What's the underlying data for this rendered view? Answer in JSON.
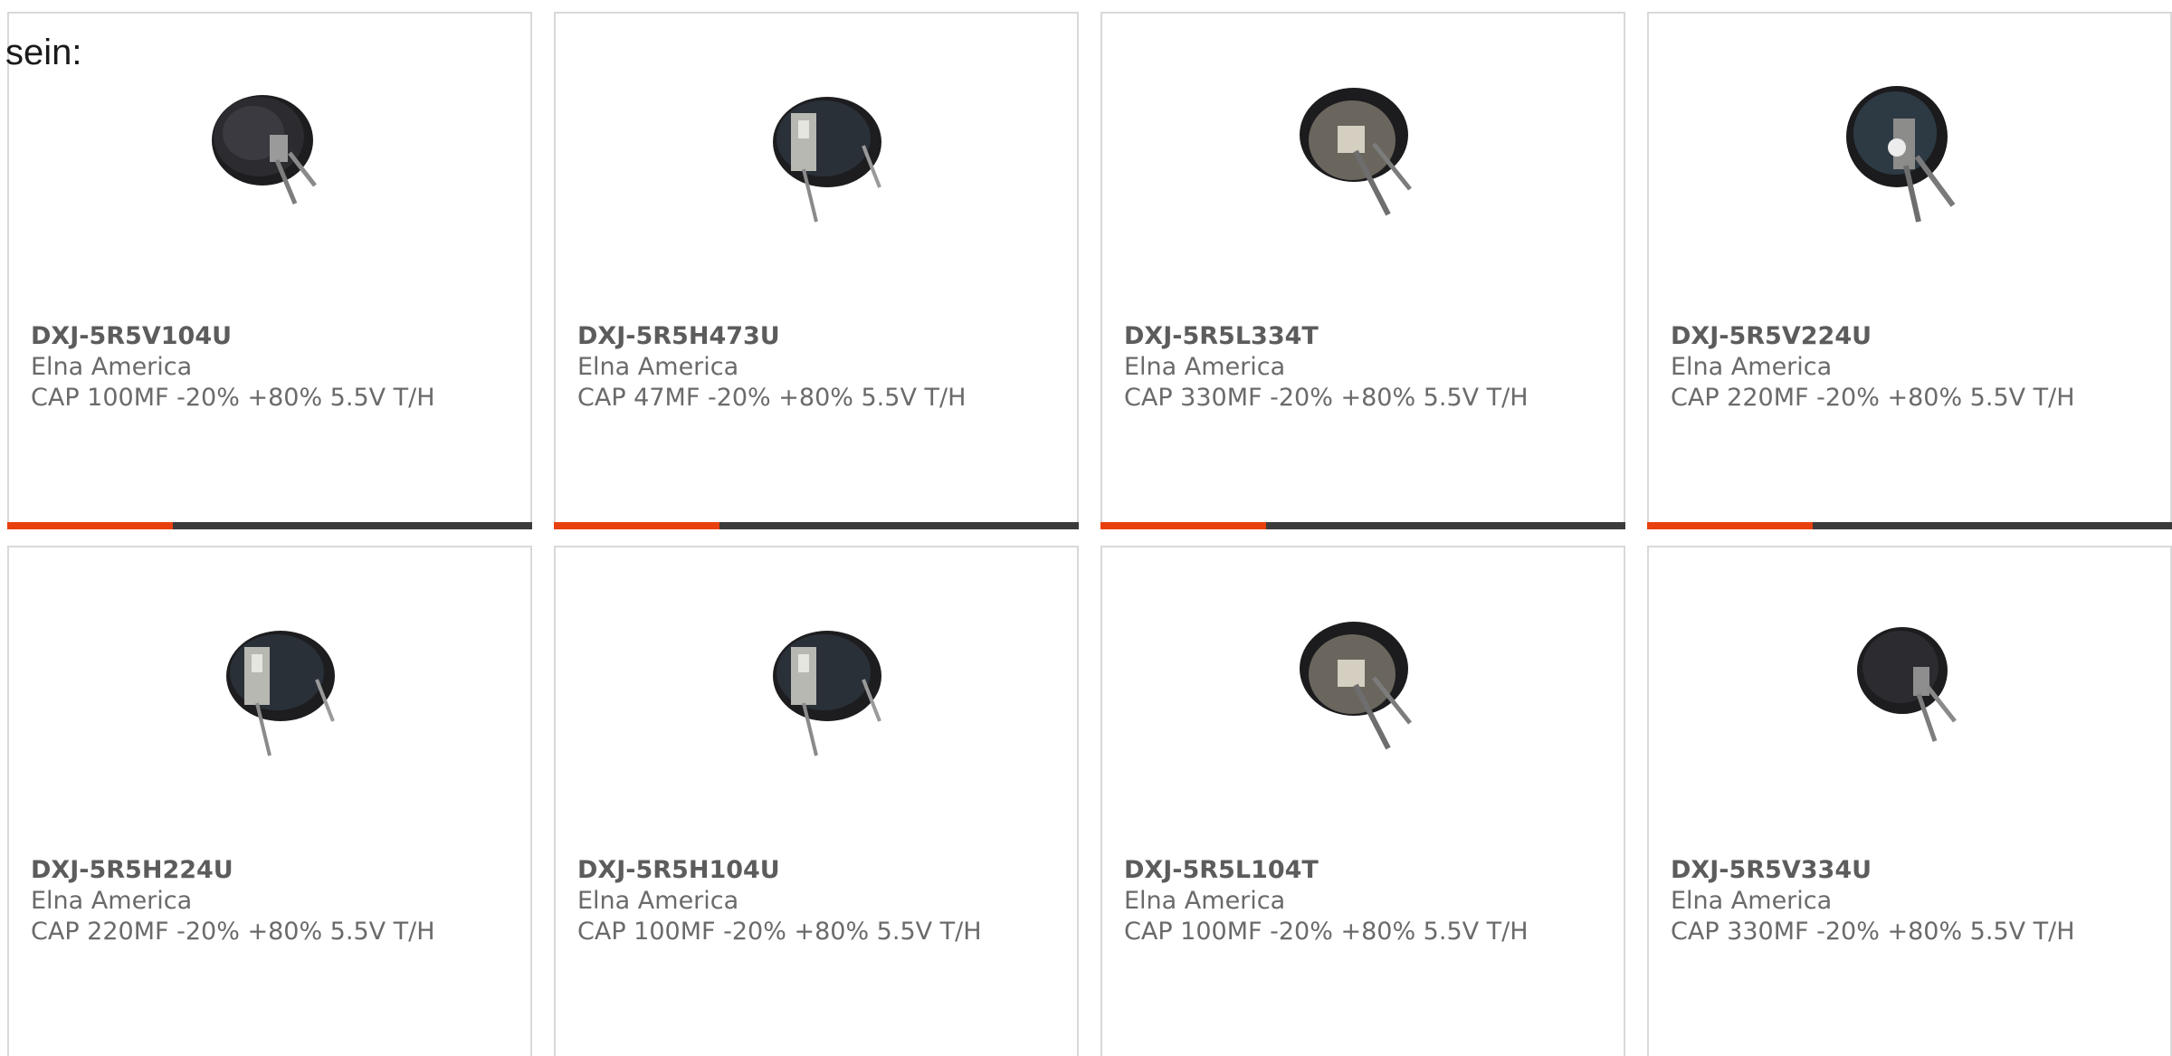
{
  "intro_text": "sein:",
  "colors": {
    "accent": "#e8410f",
    "bar": "#3b3b3b",
    "border": "#d9d9d9"
  },
  "products": [
    {
      "part_number": "DXJ-5R5V104U",
      "manufacturer": "Elna America",
      "description": "CAP 100MF -20% +80% 5.5V T/H",
      "image_icon": "coin-capacitor-icon"
    },
    {
      "part_number": "DXJ-5R5H473U",
      "manufacturer": "Elna America",
      "description": "CAP 47MF -20% +80% 5.5V T/H",
      "image_icon": "coin-capacitor-icon"
    },
    {
      "part_number": "DXJ-5R5L334T",
      "manufacturer": "Elna America",
      "description": "CAP 330MF -20% +80% 5.5V T/H",
      "image_icon": "coin-capacitor-icon"
    },
    {
      "part_number": "DXJ-5R5V224U",
      "manufacturer": "Elna America",
      "description": "CAP 220MF -20% +80% 5.5V T/H",
      "image_icon": "coin-capacitor-icon"
    },
    {
      "part_number": "DXJ-5R5H224U",
      "manufacturer": "Elna America",
      "description": "CAP 220MF -20% +80% 5.5V T/H",
      "image_icon": "coin-capacitor-icon"
    },
    {
      "part_number": "DXJ-5R5H104U",
      "manufacturer": "Elna America",
      "description": "CAP 100MF -20% +80% 5.5V T/H",
      "image_icon": "coin-capacitor-icon"
    },
    {
      "part_number": "DXJ-5R5L104T",
      "manufacturer": "Elna America",
      "description": "CAP 100MF -20% +80% 5.5V T/H",
      "image_icon": "coin-capacitor-icon"
    },
    {
      "part_number": "DXJ-5R5V334U",
      "manufacturer": "Elna America",
      "description": "CAP 330MF -20% +80% 5.5V T/H",
      "image_icon": "coin-capacitor-icon"
    }
  ]
}
